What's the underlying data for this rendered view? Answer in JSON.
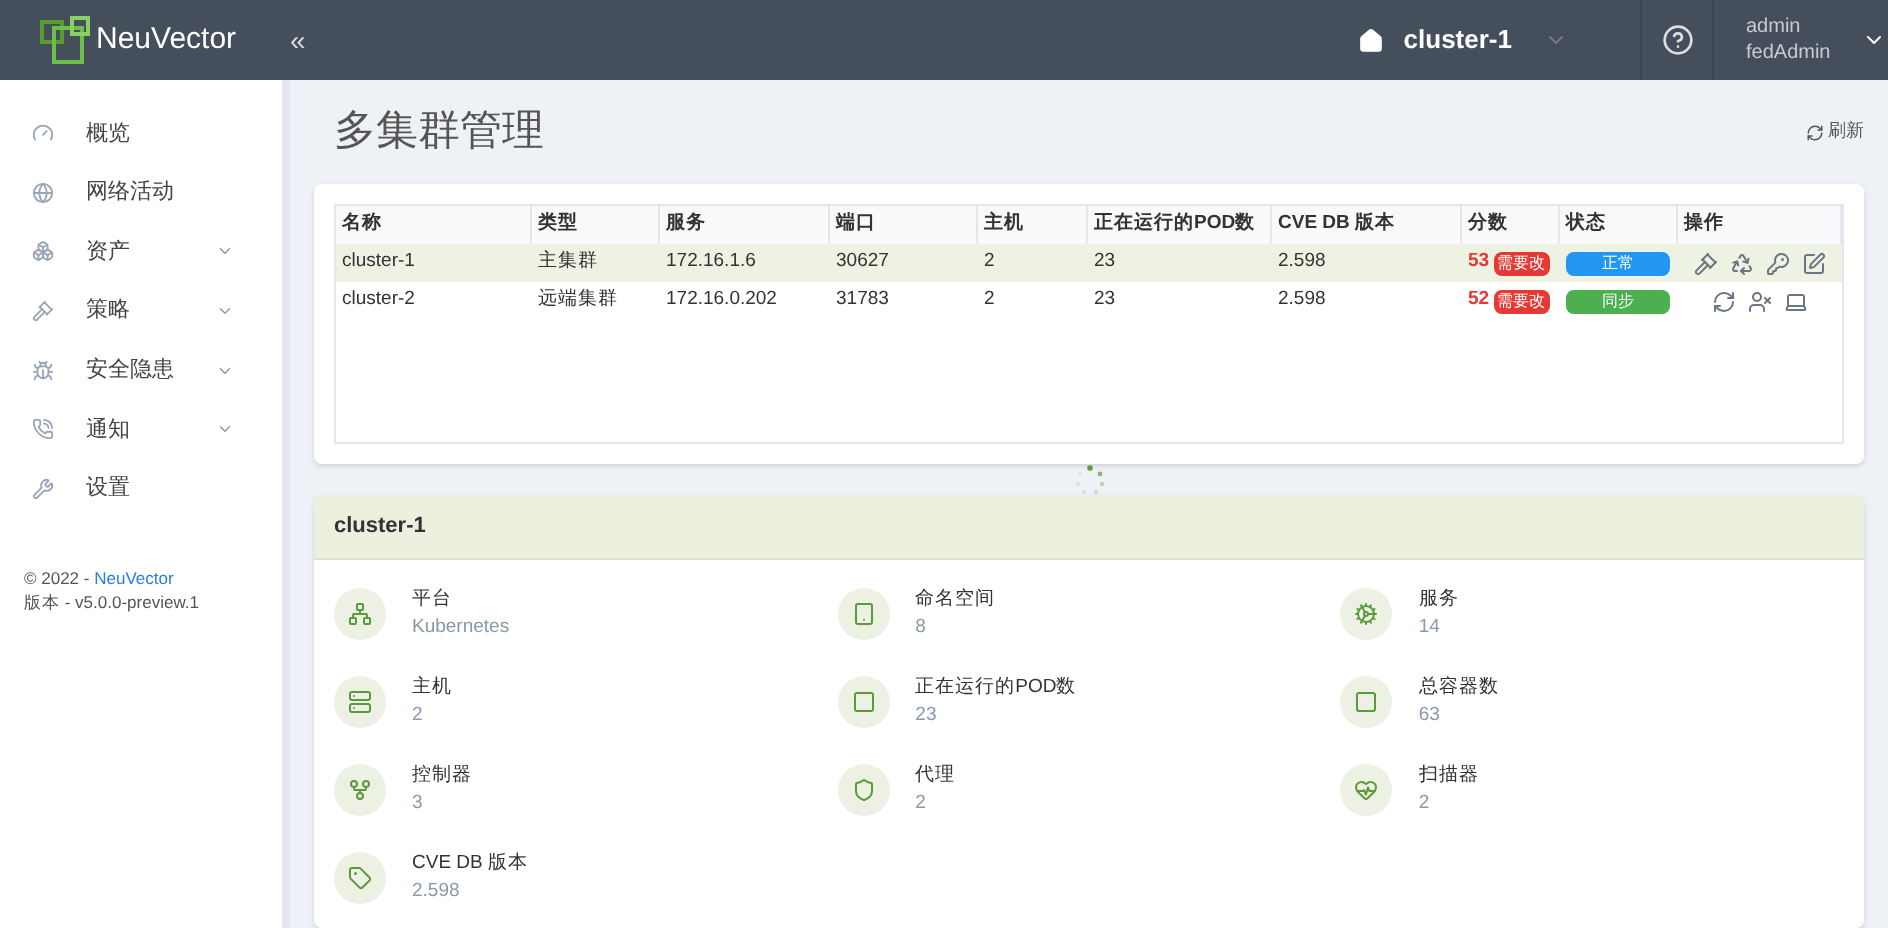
{
  "header": {
    "brand": "NeuVector",
    "collapse": "«",
    "cluster": "cluster-1",
    "user": "admin",
    "role": "fedAdmin"
  },
  "sidebar": {
    "items": [
      {
        "label": "概览",
        "expandable": false
      },
      {
        "label": "网络活动",
        "expandable": false
      },
      {
        "label": "资产",
        "expandable": true
      },
      {
        "label": "策略",
        "expandable": true
      },
      {
        "label": "安全隐患",
        "expandable": true
      },
      {
        "label": "通知",
        "expandable": true
      },
      {
        "label": "设置",
        "expandable": false
      }
    ],
    "copyright": "© 2022 -",
    "company_link": "NeuVector",
    "version": "版本 - v5.0.0-preview.1"
  },
  "page": {
    "title": "多集群管理",
    "refresh": "刷新"
  },
  "table": {
    "columns": [
      "名称",
      "类型",
      "服务",
      "端口",
      "主机",
      "正在运行的POD数",
      "CVE DB 版本",
      "分数",
      "状态",
      "操作"
    ],
    "rows": [
      {
        "kind": "primary",
        "selected": true,
        "name": "cluster-1",
        "type": "主集群",
        "service": "172.16.1.6",
        "port": "30627",
        "hosts": "2",
        "pods": "23",
        "cve_db": "2.598",
        "score": "53",
        "score_badge": "需要改",
        "status": "正常",
        "color": "#2196f3"
      },
      {
        "kind": "remote",
        "selected": false,
        "name": "cluster-2",
        "type": "远端集群",
        "service": "172.16.0.202",
        "port": "31783",
        "hosts": "2",
        "pods": "23",
        "cve_db": "2.598",
        "score": "52",
        "score_badge": "需要改",
        "status": "同步",
        "color": "#4caf50"
      }
    ]
  },
  "summary": {
    "title": "cluster-1",
    "stats": [
      {
        "label": "平台",
        "value": "Kubernetes"
      },
      {
        "label": "命名空间",
        "value": "8"
      },
      {
        "label": "服务",
        "value": "14"
      },
      {
        "label": "主机",
        "value": "2"
      },
      {
        "label": "正在运行的POD数",
        "value": "23"
      },
      {
        "label": "总容器数",
        "value": "63"
      },
      {
        "label": "控制器",
        "value": "3"
      },
      {
        "label": "代理",
        "value": "2"
      },
      {
        "label": "扫描器",
        "value": "2"
      },
      {
        "label": "CVE DB 版本",
        "value": "2.598"
      }
    ]
  }
}
